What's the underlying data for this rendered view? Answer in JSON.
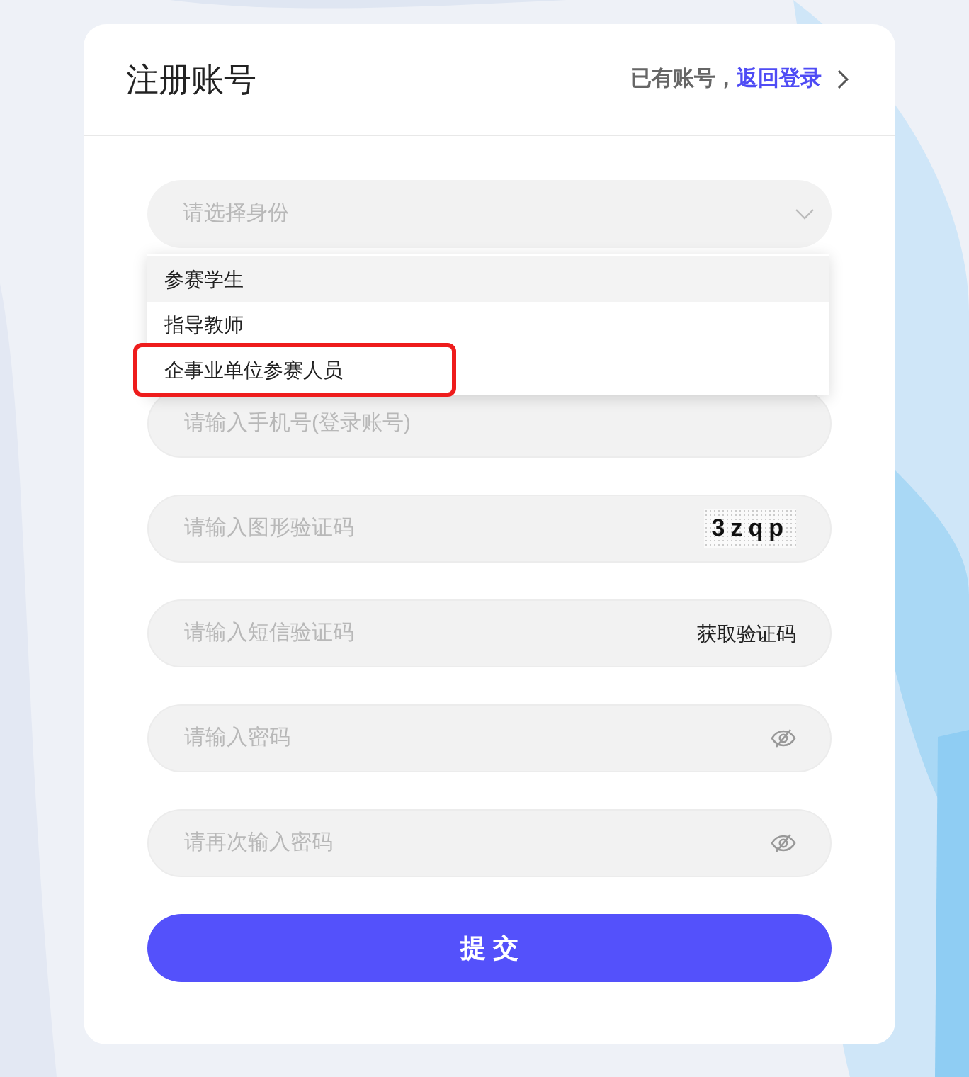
{
  "header": {
    "title": "注册账号",
    "login_prompt": "已有账号，",
    "login_link": "返回登录"
  },
  "identity_select": {
    "placeholder": "请选择身份",
    "expanded": true,
    "options": [
      {
        "label": "参赛学生",
        "highlighted": true,
        "outlined": false
      },
      {
        "label": "指导教师",
        "highlighted": false,
        "outlined": false
      },
      {
        "label": "企事业单位参赛人员",
        "highlighted": false,
        "outlined": true
      }
    ]
  },
  "fields": [
    {
      "kind": "hidden"
    },
    {
      "kind": "text",
      "placeholder": "请输入手机号(登录账号)"
    },
    {
      "kind": "captcha",
      "placeholder": "请输入图形验证码",
      "captcha": "3zqp"
    },
    {
      "kind": "sms",
      "placeholder": "请输入短信验证码",
      "action": "获取验证码"
    },
    {
      "kind": "password",
      "placeholder": "请输入密码"
    },
    {
      "kind": "password",
      "placeholder": "请再次输入密码"
    }
  ],
  "submit": "提 交"
}
